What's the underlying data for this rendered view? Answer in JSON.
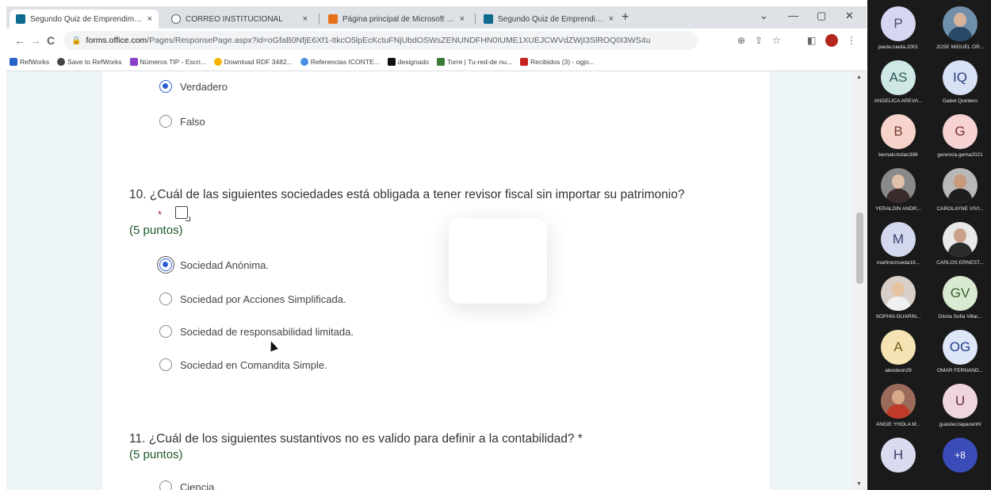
{
  "browser": {
    "tabs": [
      {
        "title": "Segundo Quiz de Emprendimien",
        "close": "×",
        "favicon_color": "#0f6a8f",
        "active": true
      },
      {
        "title": "CORREO INSTITUCIONAL",
        "close": "×",
        "favicon_color": "#9aa0a6",
        "active": false
      },
      {
        "title": "Página principal de Microsoft Of",
        "close": "×",
        "favicon_color": "#e8711c",
        "active": false
      },
      {
        "title": "Segundo Quiz de Emprendimien",
        "close": "×",
        "favicon_color": "#0f6a8f",
        "active": false
      }
    ],
    "new_tab": "+",
    "window_controls": {
      "dropdown": "⌄",
      "minimize": "—",
      "restore": "▢",
      "close": "✕"
    },
    "nav": {
      "back": "←",
      "forward": "→",
      "reload": "C"
    },
    "url": {
      "lock": "🔒",
      "host": "forms.office.com",
      "rest": "/Pages/ResponsePage.aspx?id=oGfaB0NfjE6Xf1-ItkcO5lpEcKctuFNjUbdOSWsZENUNDFHN0IUME1XUEJCWVdZWjI3SlROQ0I3WS4u"
    },
    "toolbar_icons": {
      "zoom": "⊕",
      "share": "⇪",
      "star": "☆",
      "sidepanel": "◧",
      "menu": "⋮"
    },
    "bookmarks": [
      {
        "label": "RefWorks",
        "color": "#2b64c8"
      },
      {
        "label": "Save to RefWorks",
        "color": "#444444"
      },
      {
        "label": "Números TIP - Escri...",
        "color": "#8b3fc8"
      },
      {
        "label": "Download RDF 3482...",
        "color": "#f4b400"
      },
      {
        "label": "Referencias ICONTE...",
        "color": "#4a90e2"
      },
      {
        "label": "designado",
        "color": "#111111"
      },
      {
        "label": "Torre | Tu-red-de nu...",
        "color": "#3a7a3a"
      },
      {
        "label": "Recibidos (3) - ogjo...",
        "color": "#c5221f"
      }
    ]
  },
  "form": {
    "prev_options": [
      {
        "label": "Verdadero",
        "checked": true
      },
      {
        "label": "Falso",
        "checked": false
      }
    ],
    "q10": {
      "title": "10. ¿Cuál de las siguientes sociedades está obligada a tener revisor fiscal sin importar su patrimonio?",
      "required": "*",
      "points": "(5 puntos)",
      "options": [
        {
          "label": "Sociedad Anónima.",
          "checked": true
        },
        {
          "label": "Sociedad por Acciones Simplificada.",
          "checked": false
        },
        {
          "label": "Sociedad de responsabilidad limitada.",
          "checked": false
        },
        {
          "label": "Sociedad en Comandita Simple.",
          "checked": false
        }
      ]
    },
    "q11": {
      "title": "11. ¿Cuál de los siguientes sustantivos no es valido para definir a la contabilidad? *",
      "points": "(5 puntos)",
      "options": [
        {
          "label": "Ciencia.",
          "checked": false
        }
      ]
    }
  },
  "scrollbar": {
    "up": "▲",
    "down": "▼"
  },
  "participants": [
    {
      "name": "paula.rueda.2001",
      "initials": "P",
      "bg": "#d7d6f2",
      "fg": "#4a4a6a"
    },
    {
      "name": "JOSE MIGUEL OR...",
      "initials": "",
      "bg": "#6f8faa",
      "fg": "#ffffff",
      "photo": true,
      "head": "#d8b49a",
      "body": "#2a4a6a"
    },
    {
      "name": "ANGELICA AREVA...",
      "initials": "AS",
      "bg": "#cfe8e6",
      "fg": "#2f5a56"
    },
    {
      "name": "Gabel Quintero",
      "initials": "IQ",
      "bg": "#d9e2f5",
      "fg": "#2a3f7a"
    },
    {
      "name": "bernalcristian396",
      "initials": "B",
      "bg": "#f6d4cc",
      "fg": "#7a3a2c"
    },
    {
      "name": "gerencia.gema2021",
      "initials": "G",
      "bg": "#f7d2d2",
      "fg": "#7a2c3a"
    },
    {
      "name": "YERALDIN ANDR...",
      "initials": "",
      "bg": "#8a8a8a",
      "fg": "#ffffff",
      "photo": true,
      "head": "#e0c0a8",
      "body": "#3a2a2a"
    },
    {
      "name": "CAROLAYNE VIVI...",
      "initials": "",
      "bg": "#b8b8b8",
      "fg": "#ffffff",
      "photo": true,
      "head": "#c89a7a",
      "body": "#1e1e1e"
    },
    {
      "name": "martinezrueda19...",
      "initials": "M",
      "bg": "#d4d8ee",
      "fg": "#3a4068"
    },
    {
      "name": "CARLOS ERNEST...",
      "initials": "",
      "bg": "#e8e8e8",
      "fg": "#ffffff",
      "photo": true,
      "head": "#caa088",
      "body": "#2a2a2a"
    },
    {
      "name": "SOPHIA GUARIN...",
      "initials": "",
      "bg": "#d8d0c8",
      "fg": "#ffffff",
      "photo": true,
      "head": "#e6c4a0",
      "body": "#f0f0f0"
    },
    {
      "name": "Gloria Sofia Villar...",
      "initials": "GV",
      "bg": "#d9ead3",
      "fg": "#3b5e2b"
    },
    {
      "name": "alexdeon29",
      "initials": "A",
      "bg": "#f5e3b3",
      "fg": "#7a5a1a"
    },
    {
      "name": "OMAR FERNAND...",
      "initials": "OG",
      "bg": "#dde7f7",
      "fg": "#1f3f8a"
    },
    {
      "name": "ANGIE YHOLA M...",
      "initials": "",
      "bg": "#9a6a5a",
      "fg": "#ffffff",
      "photo": true,
      "head": "#d8a888",
      "body": "#c03a2a"
    },
    {
      "name": "guasteczapacenhl",
      "initials": "U",
      "bg": "#efd6dd",
      "fg": "#6a2a3a"
    },
    {
      "name": "",
      "initials": "H",
      "bg": "#d9dbee",
      "fg": "#3a3f6a"
    },
    {
      "name": "",
      "initials": "+8",
      "bg": "#3b4cb8",
      "fg": "#ffffff"
    }
  ]
}
